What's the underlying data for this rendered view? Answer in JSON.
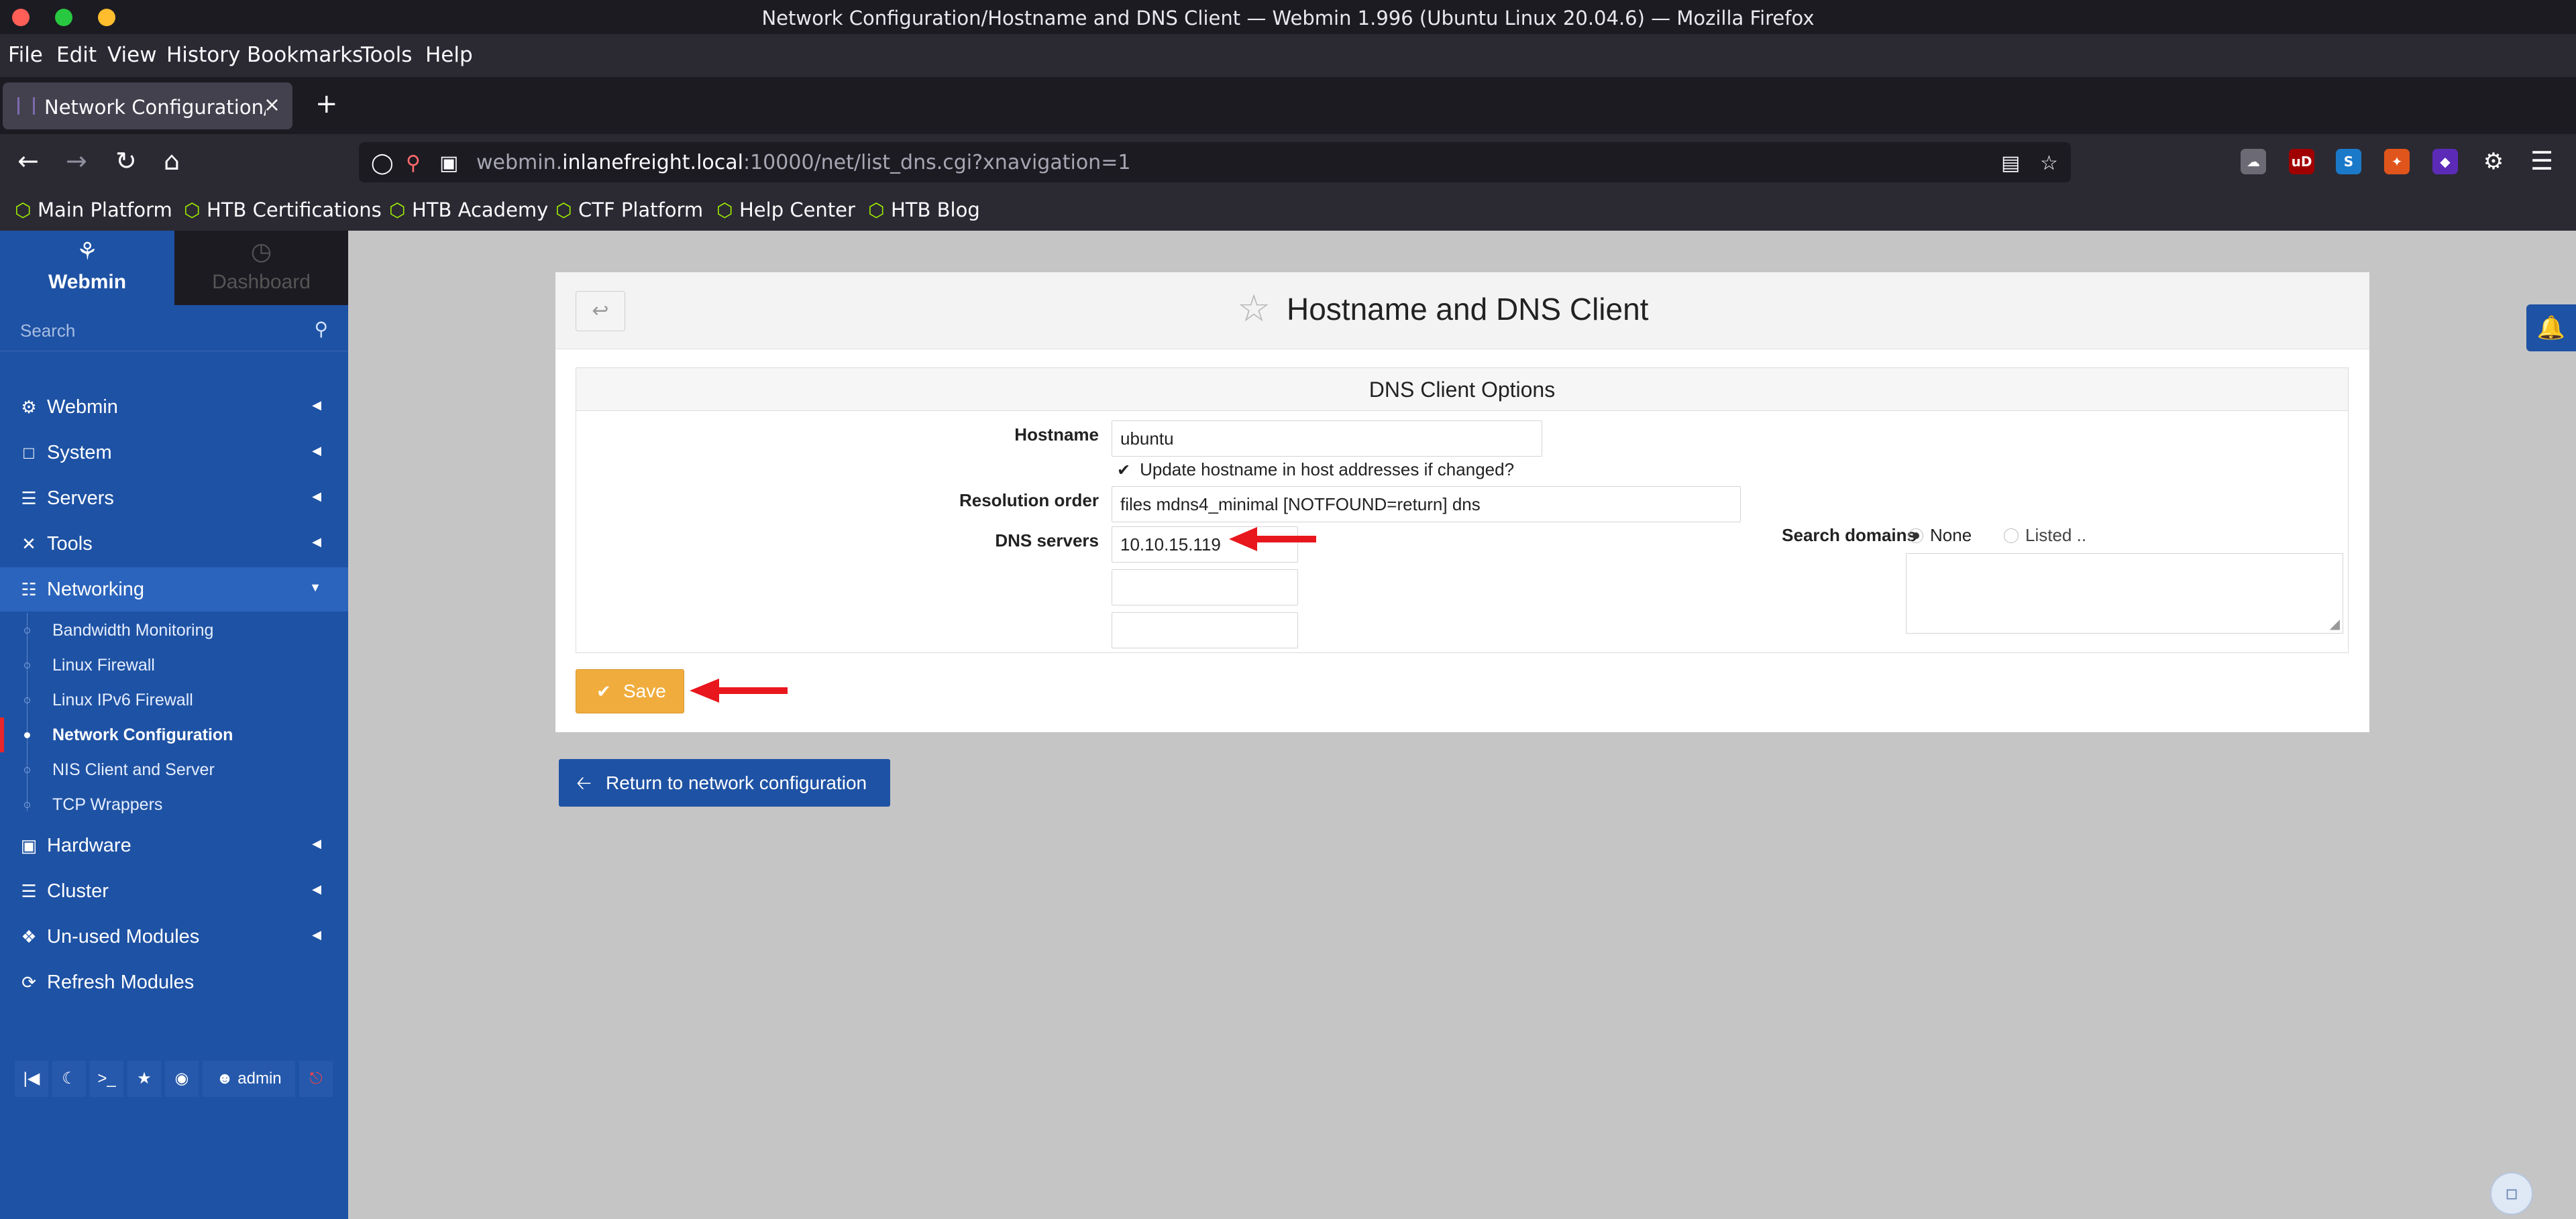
{
  "window": {
    "title": "Network Configuration/Hostname and DNS Client — Webmin 1.996 (Ubuntu Linux 20.04.6) — Mozilla Firefox",
    "controls": {
      "close_color": "#ff5f57",
      "min_color": "#28c940",
      "max_color": "#ffbd2e"
    }
  },
  "menubar": [
    "File",
    "Edit",
    "View",
    "History",
    "Bookmarks",
    "Tools",
    "Help"
  ],
  "tab": {
    "label": "Network Configuration/H",
    "close": "×",
    "new": "+"
  },
  "navbar": {
    "back": "←",
    "forward": "→",
    "reload": "↻",
    "home": "⌂",
    "url_prefix": "webmin.",
    "url_domain": "inlanefreight.local",
    "url_rest": ":10000/net/list_dns.cgi?xnavigation=1"
  },
  "bookmarks": [
    "Main Platform",
    "HTB Certifications",
    "HTB Academy",
    "CTF Platform",
    "Help Center",
    "HTB Blog"
  ],
  "sidebar": {
    "tabs": {
      "webmin": "Webmin",
      "dashboard": "Dashboard"
    },
    "search_placeholder": "Search",
    "items": [
      {
        "label": "Webmin",
        "icon": "gear-icon"
      },
      {
        "label": "System",
        "icon": "monitor-icon"
      },
      {
        "label": "Servers",
        "icon": "server-icon"
      },
      {
        "label": "Tools",
        "icon": "tools-icon"
      },
      {
        "label": "Networking",
        "icon": "network-icon"
      },
      {
        "label": "Hardware",
        "icon": "hdd-icon"
      },
      {
        "label": "Cluster",
        "icon": "layers-icon"
      },
      {
        "label": "Un-used Modules",
        "icon": "puzzle-icon"
      },
      {
        "label": "Refresh Modules",
        "icon": "refresh-icon"
      }
    ],
    "networking_sub": [
      "Bandwidth Monitoring",
      "Linux Firewall",
      "Linux IPv6 Firewall",
      "Network Configuration",
      "NIS Client and Server",
      "TCP Wrappers"
    ],
    "footer_user": "admin"
  },
  "page": {
    "title": "Hostname and DNS Client",
    "section_title": "DNS Client Options",
    "hostname_label": "Hostname",
    "hostname_value": "ubuntu",
    "update_hosts_label": "Update hostname in host addresses if changed?",
    "resolution_label": "Resolution order",
    "resolution_value": "files mdns4_minimal [NOTFOUND=return] dns",
    "dns_servers_label": "DNS servers",
    "dns_servers": [
      "10.10.15.119",
      "",
      ""
    ],
    "search_domains_label": "Search domains",
    "search_none": "None",
    "search_listed": "Listed ..",
    "save_label": "Save",
    "return_label": "Return to network configuration"
  },
  "colors": {
    "accent_blue": "#1e52a4",
    "save_orange": "#f0ad3e",
    "annotation_red": "#e8171d",
    "active_marker": "#e8252a"
  }
}
